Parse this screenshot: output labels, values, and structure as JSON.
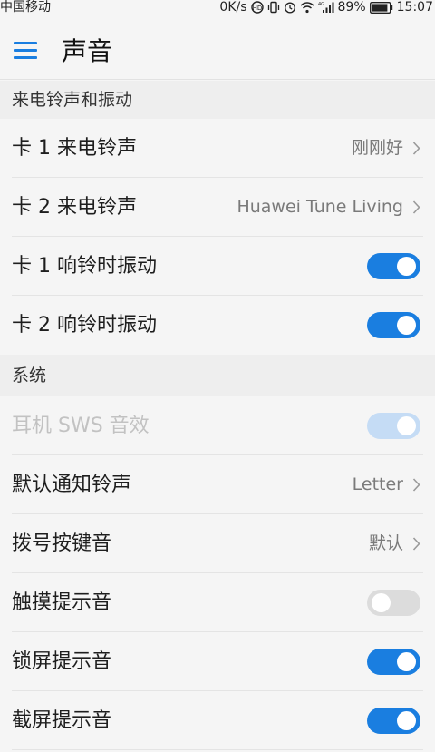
{
  "status_bar": {
    "carrier": "中国移动",
    "speed": "0K/s",
    "battery": "89%",
    "time": "15:07",
    "icons": [
      "hd-icon",
      "vibrate-icon",
      "alarm-icon",
      "wifi-icon",
      "signal-icon",
      "battery-icon"
    ]
  },
  "header": {
    "menu_icon": "hamburger-menu-icon",
    "title": "声音"
  },
  "sections": {
    "call": "来电铃声和振动",
    "system": "系统"
  },
  "rows": {
    "sim1_ringtone": {
      "label": "卡 1 来电铃声",
      "value": "刚刚好"
    },
    "sim2_ringtone": {
      "label": "卡 2 来电铃声",
      "value": "Huawei Tune Living"
    },
    "sim1_vibrate": {
      "label": "卡 1 响铃时振动",
      "on": true
    },
    "sim2_vibrate": {
      "label": "卡 2 响铃时振动",
      "on": true
    },
    "sws": {
      "label": "耳机 SWS 音效",
      "on": true,
      "enabled": false
    },
    "notification": {
      "label": "默认通知铃声",
      "value": "Letter"
    },
    "dialpad": {
      "label": "拨号按键音",
      "value": "默认"
    },
    "touch": {
      "label": "触摸提示音",
      "on": false
    },
    "lock": {
      "label": "锁屏提示音",
      "on": true
    },
    "screenshot": {
      "label": "截屏提示音",
      "on": true
    }
  },
  "colors": {
    "accent": "#1a7ee0",
    "toggle_off": "#dcdcdc",
    "toggle_disabled": "#c5dcf5"
  }
}
